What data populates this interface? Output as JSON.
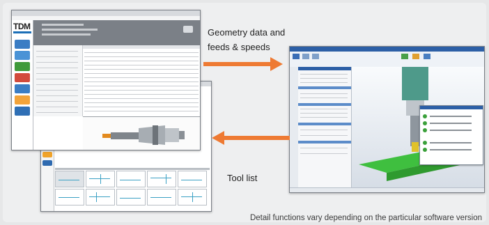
{
  "labels": {
    "geometry_line1": "Geometry data and",
    "geometry_line2": "feeds & speeds",
    "tool_list": "Tool list",
    "footnote": "Detail functions vary depending on the particular software version"
  },
  "tdm_window": {
    "logo": "TDM"
  },
  "colors": {
    "arrow": "#ee7a33",
    "tdm_blue": "#1c6fb7",
    "cam_blue": "#2c5fa6",
    "background": "#e6e7e8"
  },
  "icons": [
    "tdm-logo-icon",
    "arrow-right-icon",
    "arrow-left-icon",
    "tool-holder-3d-icon",
    "milling-machine-3d-icon"
  ]
}
